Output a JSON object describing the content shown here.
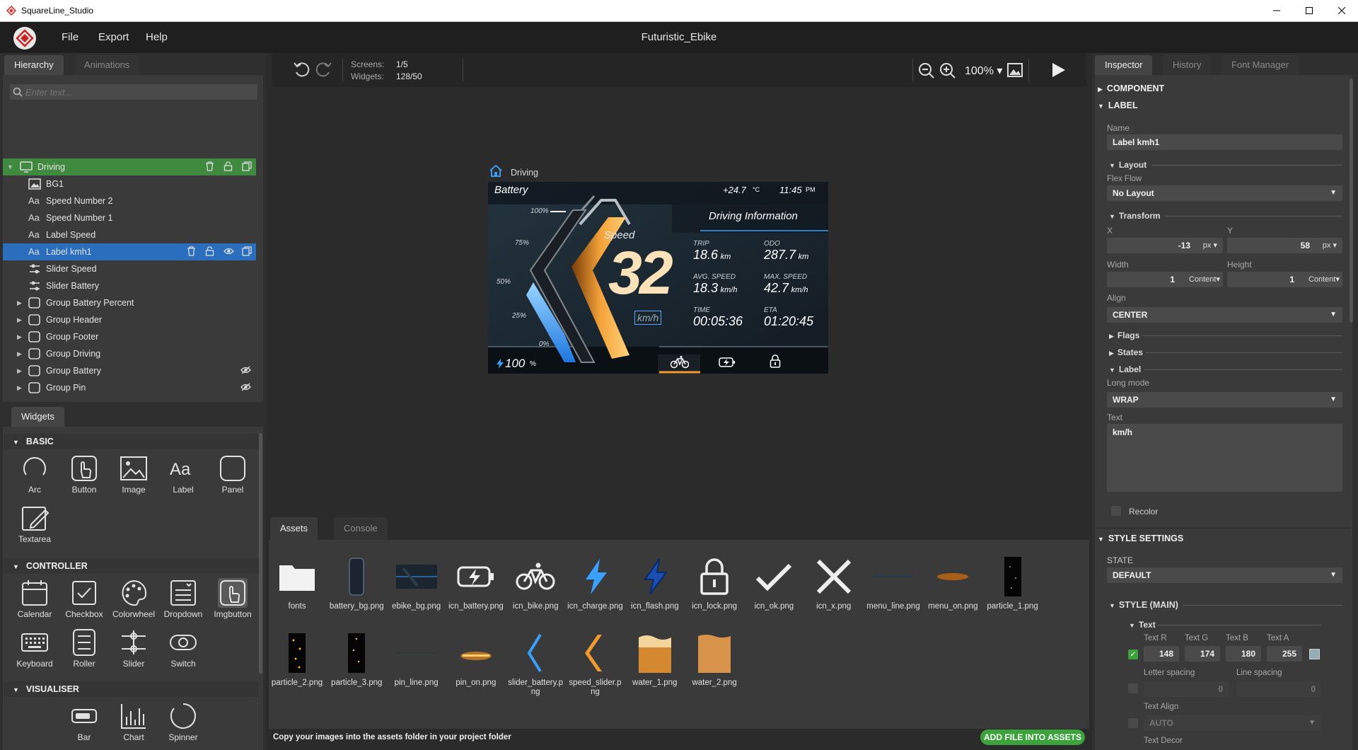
{
  "window": {
    "app_name": "SquareLine_Studio"
  },
  "menu": {
    "items": [
      "File",
      "Export",
      "Help"
    ],
    "project_title": "Futuristic_Ebike"
  },
  "left_tabs": {
    "hierarchy": "Hierarchy",
    "animations": "Animations"
  },
  "hierarchy": {
    "search_placeholder": "Enter text...",
    "rows": [
      {
        "label": "Driving",
        "icon": "screen-icon"
      },
      {
        "label": "BG1",
        "icon": "image-icon"
      },
      {
        "label": "Speed Number 2",
        "icon": "label-icon"
      },
      {
        "label": "Speed Number 1",
        "icon": "label-icon"
      },
      {
        "label": "Label Speed",
        "icon": "label-icon"
      },
      {
        "label": "Label kmh1",
        "icon": "label-icon"
      },
      {
        "label": "Slider Speed",
        "icon": "slider-icon"
      },
      {
        "label": "Slider Battery",
        "icon": "slider-icon"
      },
      {
        "label": "Group Battery Percent",
        "icon": "panel-icon"
      },
      {
        "label": "Group Header",
        "icon": "panel-icon"
      },
      {
        "label": "Group Footer",
        "icon": "panel-icon"
      },
      {
        "label": "Group Driving",
        "icon": "panel-icon"
      },
      {
        "label": "Group Battery",
        "icon": "panel-icon"
      },
      {
        "label": "Group Pin",
        "icon": "panel-icon"
      }
    ]
  },
  "widgets": {
    "tab": "Widgets",
    "basic_title": "BASIC",
    "basic": [
      "Arc",
      "Button",
      "Image",
      "Label",
      "Panel",
      "Textarea"
    ],
    "controller_title": "CONTROLLER",
    "controller": [
      "Calendar",
      "Checkbox",
      "Colorwheel",
      "Dropdown",
      "Imgbutton",
      "Keyboard",
      "Roller",
      "Slider",
      "Switch"
    ],
    "visualiser_title": "VISUALISER",
    "visualiser": [
      "Bar",
      "Chart",
      "Spinner"
    ]
  },
  "toolbar": {
    "screens_label": "Screens:",
    "screens_value": "1/5",
    "widgets_label": "Widgets:",
    "widgets_value": "128/50",
    "zoom": "100%"
  },
  "preview": {
    "screen_name": "Driving",
    "battery_title": "Battery",
    "temperature": "+24.7",
    "temp_unit": "°C",
    "time": "11:45",
    "time_suffix": "PM",
    "info_title": "Driving Information",
    "pct_marks": [
      "100%",
      "75%",
      "50%",
      "25%",
      "0%"
    ],
    "speed_label": "Speed",
    "speed_value": "32",
    "speed_unit": "km/h",
    "stats": [
      {
        "label": "TRIP",
        "value": "18.6",
        "unit": "km"
      },
      {
        "label": "ODO",
        "value": "287.7",
        "unit": "km"
      },
      {
        "label": "AVG. SPEED",
        "value": "18.3",
        "unit": "km/h"
      },
      {
        "label": "MAX. SPEED",
        "value": "42.7",
        "unit": "km/h"
      },
      {
        "label": "TIME",
        "value": "00:05:36",
        "unit": ""
      },
      {
        "label": "ETA",
        "value": "01:20:45",
        "unit": ""
      }
    ],
    "battery_value": "100",
    "battery_unit": "%"
  },
  "bottom_tabs": {
    "assets": "Assets",
    "console": "Console"
  },
  "assets": [
    "fonts",
    "battery_bg.png",
    "ebike_bg.png",
    "icn_battery.png",
    "icn_bike.png",
    "icn_charge.png",
    "icn_flash.png",
    "icn_lock.png",
    "icn_ok.png",
    "icn_x.png",
    "menu_line.png",
    "menu_on.png",
    "particle_1.png",
    "particle_2.png",
    "particle_3.png",
    "pin_line.png",
    "pin_on.png",
    "slider_battery.png",
    "speed_slider.png",
    "water_1.png",
    "water_2.png"
  ],
  "status": {
    "hint": "Copy your images into the assets folder in your project folder",
    "add_button": "ADD FILE INTO ASSETS"
  },
  "inspector": {
    "tabs": [
      "Inspector",
      "History",
      "Font Manager"
    ],
    "component": "COMPONENT",
    "label_section": "LABEL",
    "name_label": "Name",
    "name_value": "Label kmh1",
    "layout_title": "Layout",
    "flex_flow_label": "Flex Flow",
    "flex_flow_value": "No Layout",
    "transform_title": "Transform",
    "x_label": "X",
    "x_value": "-13",
    "x_unit": "px",
    "y_label": "Y",
    "y_value": "58",
    "y_unit": "px",
    "width_label": "Width",
    "width_value": "1",
    "width_unit": "Content",
    "height_label": "Height",
    "height_value": "1",
    "height_unit": "Content",
    "align_label": "Align",
    "align_value": "CENTER",
    "flags_title": "Flags",
    "states_title": "States",
    "label_title": "Label",
    "long_mode_label": "Long mode",
    "long_mode_value": "WRAP",
    "text_label": "Text",
    "text_value": "km/h",
    "recolor_label": "Recolor",
    "style_settings": "STYLE SETTINGS",
    "state_label": "STATE",
    "state_value": "DEFAULT",
    "style_main": "STYLE (MAIN)",
    "text_sub": "Text",
    "rgba_labels": [
      "Text R",
      "Text G",
      "Text B",
      "Text A"
    ],
    "rgba_values": [
      "148",
      "174",
      "180",
      "255"
    ],
    "text_color": "#94aeb4",
    "letter_spacing_label": "Letter spacing",
    "letter_spacing_value": "0",
    "line_spacing_label": "Line spacing",
    "line_spacing_value": "0",
    "text_align_label": "Text Align",
    "text_align_value": "AUTO",
    "text_decor_label": "Text Decor"
  },
  "colors": {
    "selected_screen": "#3f8a3f",
    "selected_row": "#2a6ebd",
    "accent_orange": "#f29a2e",
    "accent_blue": "#3aa0ff",
    "add_button": "#3ca23c"
  }
}
